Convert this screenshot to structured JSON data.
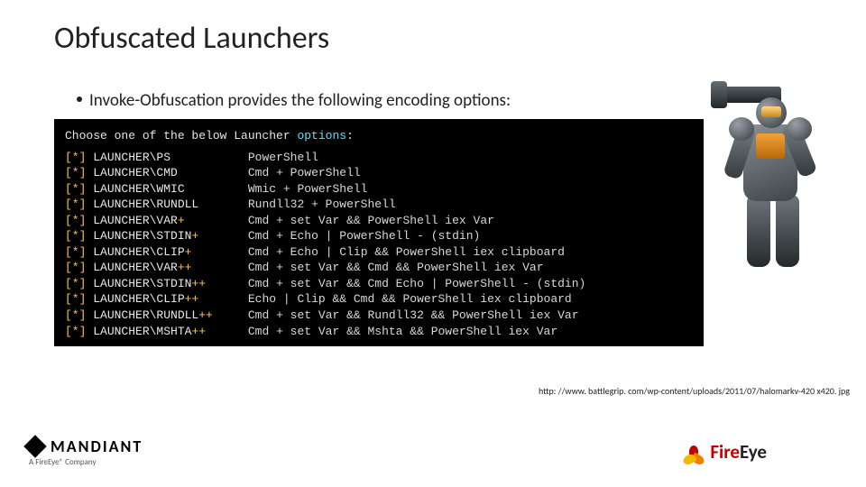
{
  "title": "Obfuscated Launchers",
  "bullet": "Invoke-Obfuscation provides the following encoding options:",
  "terminal": {
    "header_pre": "Choose one of the below Launcher ",
    "header_cyan": "options",
    "header_post": ":",
    "marker": "[*]",
    "rows": [
      {
        "name": "LAUNCHER\\PS",
        "mode": "",
        "desc": "PowerShell"
      },
      {
        "name": "LAUNCHER\\CMD",
        "mode": "",
        "desc": "Cmd + PowerShell"
      },
      {
        "name": "LAUNCHER\\WMIC",
        "mode": "",
        "desc": "Wmic + PowerShell"
      },
      {
        "name": "LAUNCHER\\RUNDLL",
        "mode": "",
        "desc": "Rundll32 + PowerShell"
      },
      {
        "name": "LAUNCHER\\VAR",
        "mode": "+",
        "desc": "Cmd + set Var && PowerShell iex Var"
      },
      {
        "name": "LAUNCHER\\STDIN",
        "mode": "+",
        "desc": "Cmd + Echo | PowerShell - (stdin)"
      },
      {
        "name": "LAUNCHER\\CLIP",
        "mode": "+",
        "desc": "Cmd + Echo | Clip && PowerShell iex clipboard"
      },
      {
        "name": "LAUNCHER\\VAR",
        "mode": "++",
        "desc": "Cmd + set Var && Cmd && PowerShell iex Var"
      },
      {
        "name": "LAUNCHER\\STDIN",
        "mode": "++",
        "desc": "Cmd + set Var && Cmd Echo | PowerShell - (stdin)"
      },
      {
        "name": "LAUNCHER\\CLIP",
        "mode": "++",
        "desc": "Echo | Clip && Cmd && PowerShell iex clipboard"
      },
      {
        "name": "LAUNCHER\\RUNDLL",
        "mode": "++",
        "desc": "Cmd + set Var && Rundll32 && PowerShell iex Var"
      },
      {
        "name": "LAUNCHER\\MSHTA",
        "mode": "++",
        "desc": "Cmd + set Var && Mshta && PowerShell iex Var"
      }
    ]
  },
  "image_url": "http: //www. battlegrip. com/wp-content/uploads/2011/07/halomarkv-420 x420. jpg",
  "mandiant": {
    "name": "MANDIANT",
    "sub": "A FireEye® Company"
  },
  "fireeye": {
    "fire": "Fire",
    "eye": "Eye"
  }
}
